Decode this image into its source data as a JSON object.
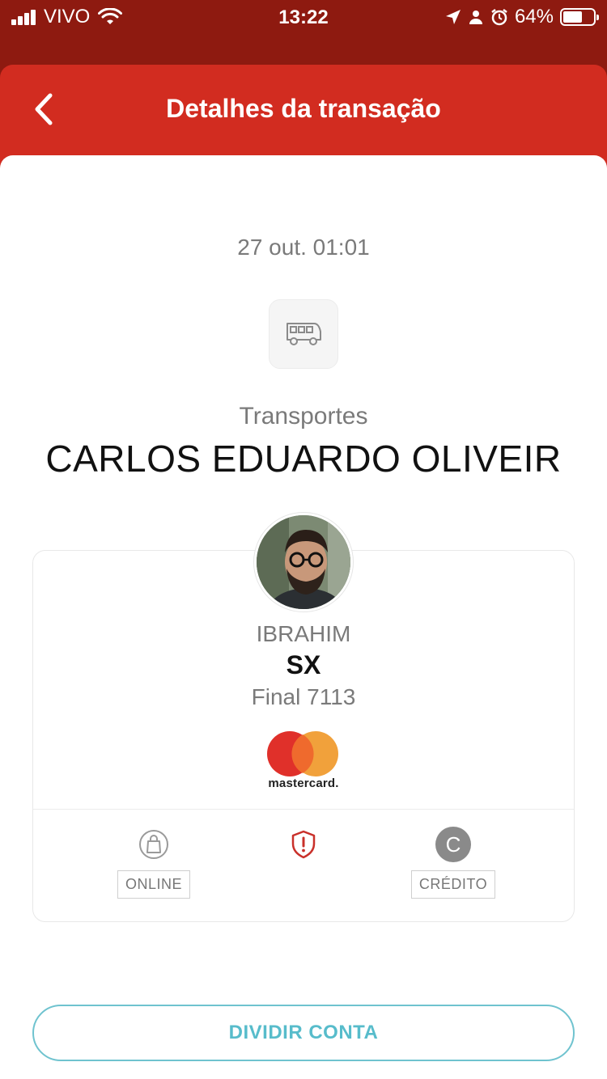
{
  "status_bar": {
    "carrier": "VIVO",
    "time": "13:22",
    "battery": "64%",
    "battery_level": 0.64
  },
  "header": {
    "title": "Detalhes da transação",
    "back_icon": "chevron-left-icon"
  },
  "transaction": {
    "date": "27 out. 01:01",
    "category_icon": "bus-icon",
    "category": "Transportes",
    "merchant": "CARLOS EDUARDO OLIVEIR"
  },
  "card": {
    "holder": "IBRAHIM",
    "name": "SX",
    "final": "Final 7113",
    "brand_wordmark": "mastercard.",
    "features": {
      "online": {
        "icon": "shopping-bag-icon",
        "label": "ONLINE"
      },
      "alert": {
        "icon": "shield-alert-icon"
      },
      "credit": {
        "icon_letter": "C",
        "label": "CRÉDITO"
      }
    }
  },
  "actions": {
    "split_label": "DIVIDIR CONTA"
  },
  "colors": {
    "header_red": "#d22c20",
    "statusbar_red": "#8e1a10",
    "accent_teal": "#57bccb",
    "mc_red": "#e0302a",
    "mc_orange": "#f09a2c"
  }
}
